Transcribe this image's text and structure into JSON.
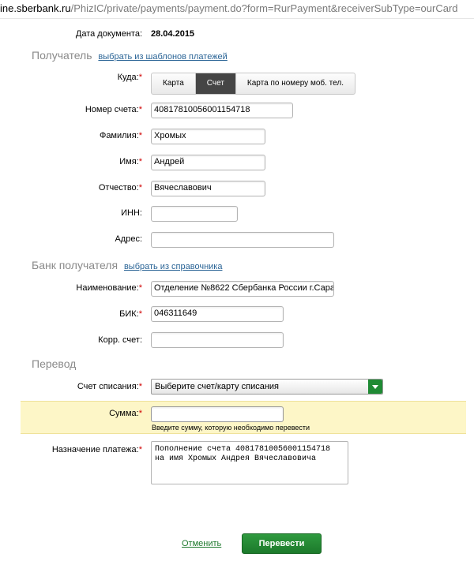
{
  "address_bar": {
    "host": "ine.sberbank.ru",
    "path": "/PhizIC/private/payments/payment.do?form=RurPayment&receiverSubType=ourCard"
  },
  "doc_date": {
    "label": "Дата документа:",
    "value": "28.04.2015"
  },
  "recipient": {
    "title": "Получатель",
    "link": "выбрать из шаблонов платежей",
    "where": {
      "label": "Куда:",
      "options": [
        "Карта",
        "Счет",
        "Карта по номеру моб. тел."
      ],
      "selected": "Счет"
    },
    "account": {
      "label": "Номер счета:",
      "value": "40817810056001154718"
    },
    "last_name": {
      "label": "Фамилия:",
      "value": "Хромых"
    },
    "first_name": {
      "label": "Имя:",
      "value": "Андрей"
    },
    "patronymic": {
      "label": "Отчество:",
      "value": "Вячеславович"
    },
    "inn": {
      "label": "ИНН:",
      "value": ""
    },
    "address": {
      "label": "Адрес:",
      "value": ""
    }
  },
  "bank": {
    "title": "Банк получателя",
    "link": "выбрать из справочника",
    "name": {
      "label": "Наименование:",
      "value": "Отделение №8622 Сбербанка России г.Сара"
    },
    "bik": {
      "label": "БИК:",
      "value": "046311649"
    },
    "corr": {
      "label": "Корр. счет:",
      "value": ""
    }
  },
  "transfer": {
    "title": "Перевод",
    "debit": {
      "label": "Счет списания:",
      "value": "Выберите счет/карту списания"
    },
    "amount": {
      "label": "Сумма:",
      "value": "",
      "hint": "Введите сумму, которую необходимо перевести"
    },
    "purpose": {
      "label": "Назначение платежа:",
      "value": "Пополнение счета 40817810056001154718 на имя Хромых Андрея Вячеславовича"
    }
  },
  "actions": {
    "cancel": "Отменить",
    "submit": "Перевести"
  },
  "colors": {
    "accent_green": "#1f8a34",
    "required": "#d00000",
    "highlight": "#fdf6c7"
  }
}
